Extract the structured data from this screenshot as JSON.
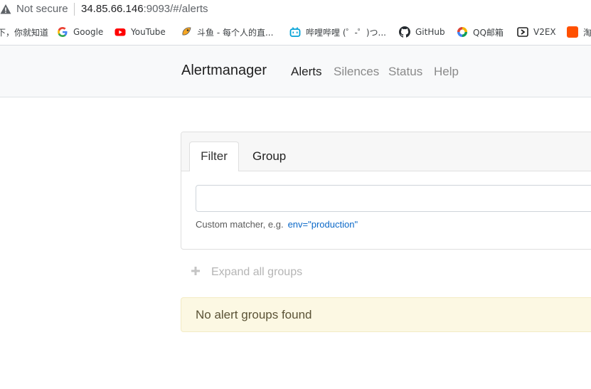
{
  "browser": {
    "security_label": "Not secure",
    "url_host": "34.85.66.146",
    "url_rest": ":9093/#/alerts",
    "icons": {
      "security": "warning-triangle-icon"
    }
  },
  "bookmarks": [
    {
      "label": "下，你就知道",
      "icon": "baidu-icon"
    },
    {
      "label": "Google",
      "icon": "google-icon"
    },
    {
      "label": "YouTube",
      "icon": "youtube-icon"
    },
    {
      "label": "斗鱼 - 每个人的直...",
      "icon": "douyu-icon"
    },
    {
      "label": "哔哩哔哩 (゜-゜)つ...",
      "icon": "bilibili-icon"
    },
    {
      "label": "GitHub",
      "icon": "github-icon"
    },
    {
      "label": "QQ邮箱",
      "icon": "qqmail-icon"
    },
    {
      "label": "V2EX",
      "icon": "v2ex-icon"
    },
    {
      "label": "淘",
      "icon": "taobao-icon"
    }
  ],
  "navbar": {
    "brand": "Alertmanager",
    "links": [
      {
        "label": "Alerts",
        "active": true
      },
      {
        "label": "Silences",
        "active": false
      },
      {
        "label": "Status",
        "active": false
      },
      {
        "label": "Help",
        "active": false
      }
    ]
  },
  "filter": {
    "tabs": [
      {
        "label": "Filter",
        "active": true
      },
      {
        "label": "Group",
        "active": false
      }
    ],
    "input_value": "",
    "hint_text": "Custom matcher, e.g.",
    "hint_example": "env=\"production\""
  },
  "expand_label": "Expand all groups",
  "alert_message": "No alert groups found",
  "colors": {
    "navbar_bg": "#f8f9fa",
    "link_blue": "#0a68c8",
    "alert_bg": "#fcf8e3"
  }
}
